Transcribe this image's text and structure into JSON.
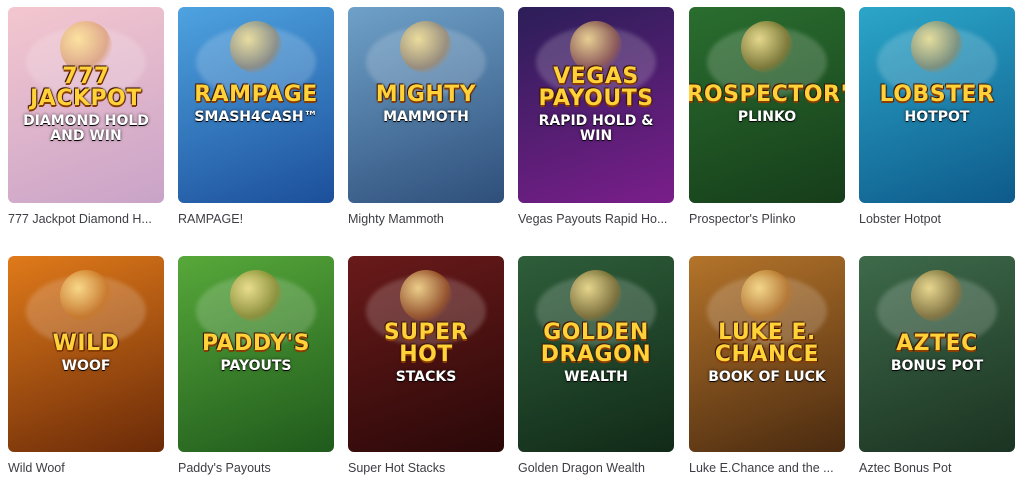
{
  "games": [
    {
      "title": "777 Jackpot Diamond H...",
      "logo_main": "777 JACKPOT",
      "logo_sub": "DIAMOND Hold and Win",
      "art_icon": "slot-777-icon",
      "colors": [
        "#f4c7cf",
        "#c9a3c8"
      ]
    },
    {
      "title": "RAMPAGE!",
      "logo_main": "RAMPAGE",
      "logo_sub": "SMASH4CASH™",
      "art_icon": "bottle-icon",
      "colors": [
        "#4ea3e0",
        "#1c4f9a"
      ]
    },
    {
      "title": "Mighty Mammoth",
      "logo_main": "MIGHTY",
      "logo_sub": "MAMMOTH",
      "art_icon": "mammoth-icon",
      "colors": [
        "#6fa1c8",
        "#2e4f7a"
      ]
    },
    {
      "title": "Vegas Payouts Rapid Ho...",
      "logo_main": "Vegas PAYOUTS",
      "logo_sub": "RAPID HOLD & WIN",
      "art_icon": "city-skyline-icon",
      "colors": [
        "#2b1e58",
        "#7a1e8a"
      ]
    },
    {
      "title": "Prospector's Plinko",
      "logo_main": "PROSPECTOR'S",
      "logo_sub": "PLINKO",
      "art_icon": "miner-icon",
      "colors": [
        "#2a6e2f",
        "#163d1a"
      ]
    },
    {
      "title": "Lobster Hotpot",
      "logo_main": "LOBSTER",
      "logo_sub": "HOTPOT",
      "art_icon": "lobster-icon",
      "colors": [
        "#2ba6c9",
        "#0e5a8a"
      ]
    },
    {
      "title": "Wild Woof",
      "logo_main": "WILD",
      "logo_sub": "WOOF",
      "art_icon": "dog-sheriff-icon",
      "colors": [
        "#e07a1a",
        "#6a2a08"
      ]
    },
    {
      "title": "Paddy's Payouts",
      "logo_main": "PADDY'S",
      "logo_sub": "PAYOUTS",
      "art_icon": "leprechaun-icon",
      "colors": [
        "#57a83a",
        "#1f5a1c"
      ]
    },
    {
      "title": "Super Hot Stacks",
      "logo_main": "SUPER HOT",
      "logo_sub": "STACKS",
      "art_icon": "fruit-icon",
      "colors": [
        "#6a1a1a",
        "#2a0808"
      ]
    },
    {
      "title": "Golden Dragon Wealth",
      "logo_main": "GOLDEN DRAGON",
      "logo_sub": "WEALTH",
      "art_icon": "dragon-icon",
      "colors": [
        "#2e5e3a",
        "#112a18"
      ]
    },
    {
      "title": "Luke E.Chance and the ...",
      "logo_main": "LUKE E. CHANCE",
      "logo_sub": "BOOK OF LUCK",
      "art_icon": "explorer-icon",
      "colors": [
        "#b4742a",
        "#4a2a10"
      ]
    },
    {
      "title": "Aztec Bonus Pot",
      "logo_main": "AZTEC",
      "logo_sub": "BONUS POT",
      "art_icon": "aztec-pyramid-icon",
      "colors": [
        "#3e6a4a",
        "#1b3322"
      ]
    }
  ]
}
